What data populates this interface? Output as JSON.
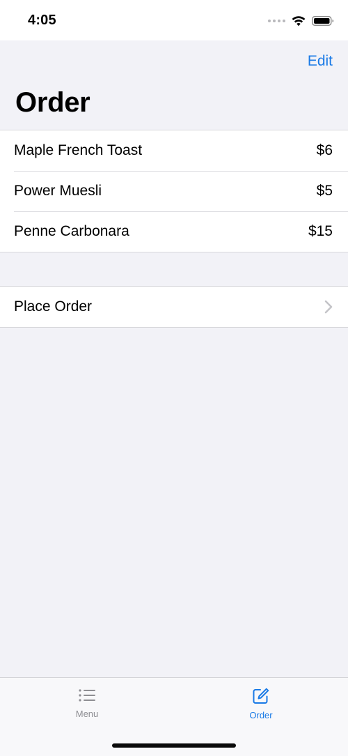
{
  "status_bar": {
    "time": "4:05",
    "icons": [
      "signal-dots-icon",
      "wifi-icon",
      "battery-icon"
    ]
  },
  "nav": {
    "edit_label": "Edit",
    "title": "Order"
  },
  "order_items": [
    {
      "name": "Maple French Toast",
      "price": "$6"
    },
    {
      "name": "Power Muesli",
      "price": "$5"
    },
    {
      "name": "Penne Carbonara",
      "price": "$15"
    }
  ],
  "place_order": {
    "label": "Place Order",
    "icon": "chevron-right-icon"
  },
  "tab_bar": {
    "tabs": [
      {
        "label": "Menu",
        "icon": "list-icon",
        "active": false
      },
      {
        "label": "Order",
        "icon": "compose-icon",
        "active": true
      }
    ]
  },
  "colors": {
    "accent": "#1a7ae6",
    "background": "#f2f2f7",
    "inactive_tab": "#8e8e93"
  }
}
